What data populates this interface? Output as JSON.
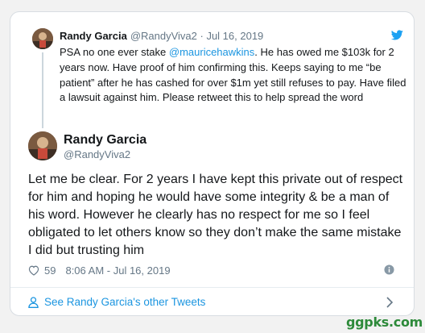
{
  "quoted_tweet": {
    "name": "Randy Garcia",
    "handle_date": "@RandyViva2 · Jul 16, 2019",
    "text_before": "PSA no one ever stake ",
    "mention": "@mauricehawkins",
    "text_after": ". He has owed me $103k for 2 years now. Have proof of him confirming this. Keeps saying to me “be patient” after he has cashed for over $1m yet still refuses to pay. Have filed a lawsuit against him. Please retweet this to help spread the word"
  },
  "main_tweet": {
    "name": "Randy Garcia",
    "handle": "@RandyViva2",
    "text": "Let me be clear. For 2 years I have kept this private out of respect for him and hoping he would have some integrity & be a man of his word. However he clearly has no respect for me so I feel obligated to let others know so they don’t make the same mistake I did but trusting him",
    "likes": "59",
    "timestamp": "8:06 AM - Jul 16, 2019"
  },
  "footer": {
    "see_more": "See Randy Garcia's other Tweets"
  },
  "watermark": "ggpks.com",
  "icons": [
    "twitter-bird-icon",
    "heart-icon",
    "info-icon",
    "person-icon",
    "chevron-right-icon"
  ],
  "colors": {
    "link": "#1b95e0",
    "muted": "#657786",
    "text": "#14171a",
    "border": "#d8dde2"
  }
}
